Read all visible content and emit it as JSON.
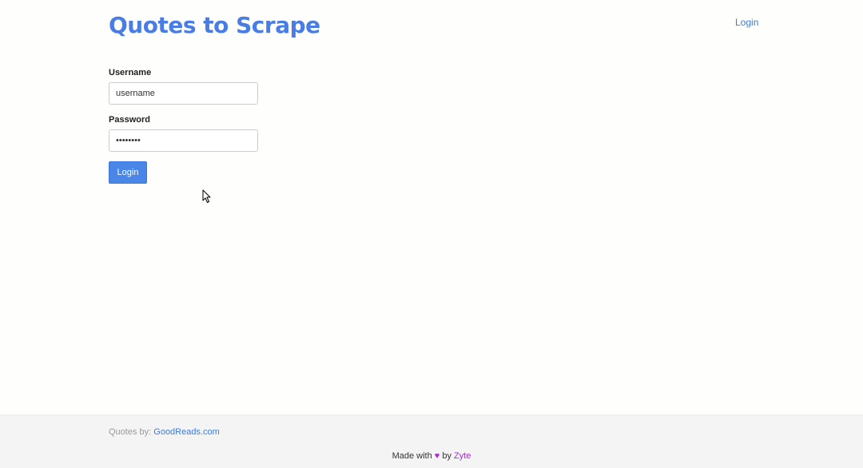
{
  "header": {
    "title": "Quotes to Scrape",
    "login_link": "Login"
  },
  "form": {
    "username_label": "Username",
    "username_value": "username",
    "password_label": "Password",
    "password_value": "password",
    "submit_label": "Login"
  },
  "footer": {
    "quotes_by_prefix": "Quotes by: ",
    "goodreads_link": "GoodReads.com",
    "made_with_prefix": "Made with ",
    "heart_glyph": "♥",
    "by_text": " by ",
    "zyte_link": "Zyte"
  },
  "colors": {
    "brand": "#4a7de3",
    "button": "#4a86e8",
    "heart": "#a92ad6",
    "footer_bg": "#f4f4f5"
  },
  "icons": {
    "cursor": "mouse-pointer-icon",
    "heart": "heart-icon"
  }
}
